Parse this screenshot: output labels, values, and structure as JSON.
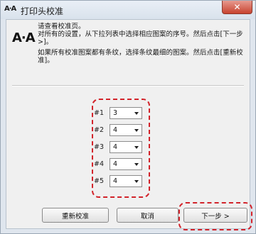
{
  "window": {
    "title": "打印头校准",
    "title_icon_text": "A·A",
    "close_label": "✕"
  },
  "content": {
    "icon_text": "A·A",
    "instructions": [
      "请查看校准页。\n对所有的设置，从下拉列表中选择相应图案的序号。然后点击[下一步 >]。",
      "如果所有校准图案都有条纹，选择条纹最细的图案。然后点击[重新校准]。"
    ]
  },
  "selectors": [
    {
      "label": "#1",
      "value": "3"
    },
    {
      "label": "#2",
      "value": "4"
    },
    {
      "label": "#3",
      "value": "4"
    },
    {
      "label": "#4",
      "value": "4"
    },
    {
      "label": "#5",
      "value": "4"
    }
  ],
  "buttons": {
    "recalibrate": "重新校准",
    "cancel": "取消",
    "next": "下一步 >"
  },
  "colors": {
    "highlight": "#d2232a"
  }
}
